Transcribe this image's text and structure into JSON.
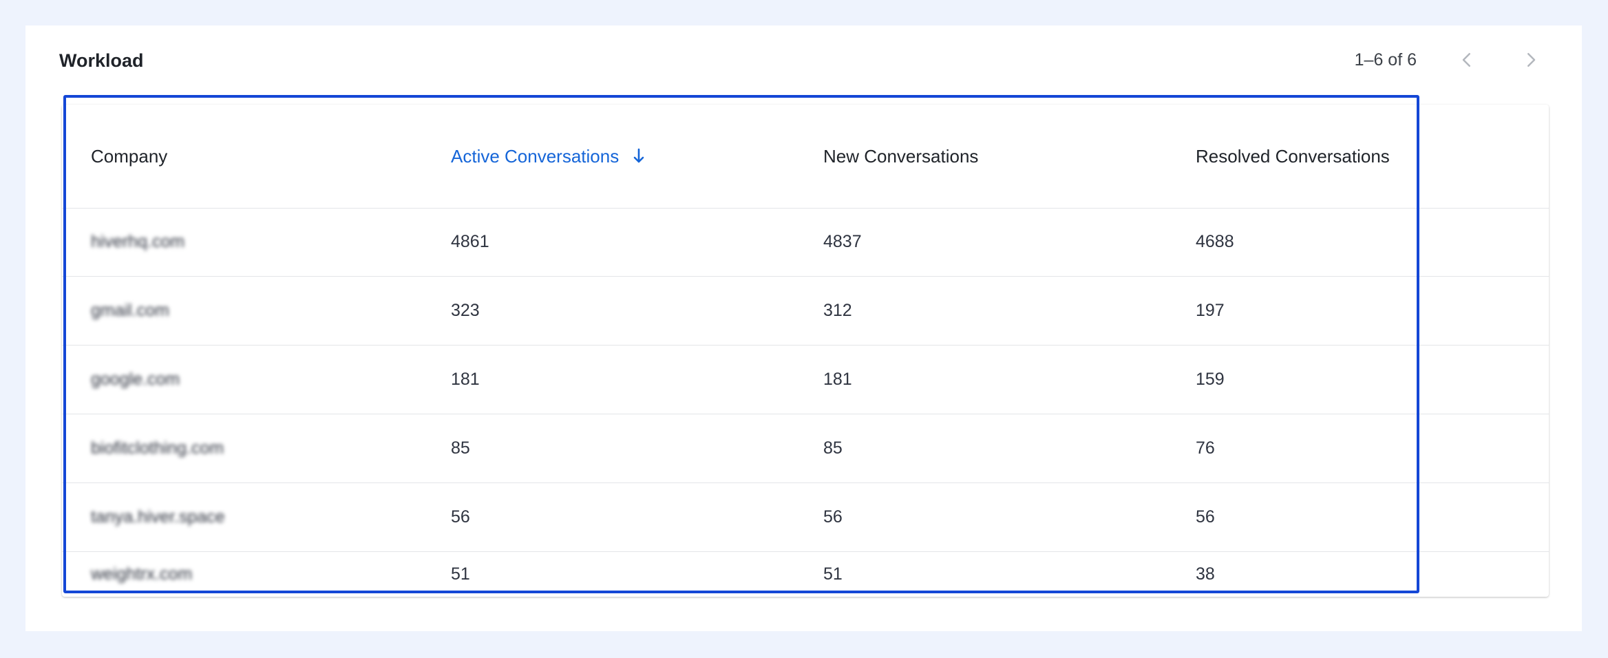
{
  "panel": {
    "title": "Workload",
    "pagination_text": "1–6 of 6",
    "prev_icon": "chevron-left",
    "next_icon": "chevron-right"
  },
  "table": {
    "headers": [
      "Company",
      "Active Conversations",
      "New Conversations",
      "Resolved Conversations"
    ],
    "sorted_column": "Active Conversations",
    "sort_direction": "descending",
    "rows": [
      [
        "hiverhq.com",
        "4861",
        "4837",
        "4688"
      ],
      [
        "gmail.com",
        "323",
        "312",
        "197"
      ],
      [
        "google.com",
        "181",
        "181",
        "159"
      ],
      [
        "biofitclothing.com",
        "85",
        "85",
        "76"
      ],
      [
        "tanya.hiver.space",
        "56",
        "56",
        "56"
      ],
      [
        "weightrx.com",
        "51",
        "51",
        "38"
      ]
    ]
  },
  "colors": {
    "accent": "#1565d8",
    "highlight_border": "#1447d6",
    "background": "#eef3fd"
  }
}
